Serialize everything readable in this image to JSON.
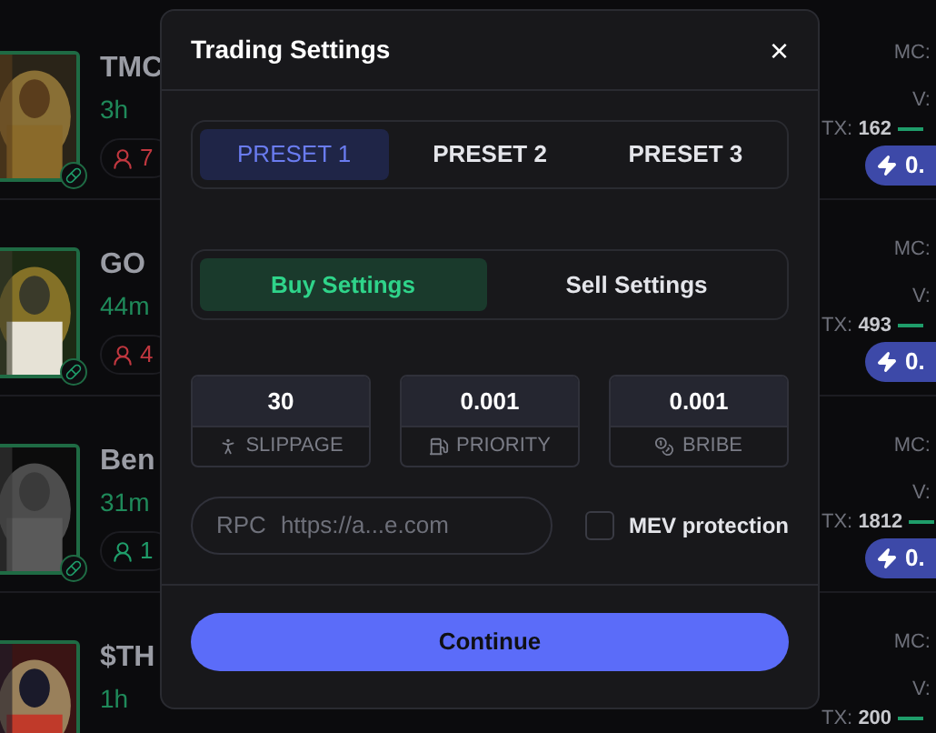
{
  "tokens": [
    {
      "name": "TMC",
      "age": "3h",
      "holders": "7",
      "color": "#c0373f",
      "mc_label": "MC:",
      "v_label": "V:",
      "tx_label": "TX:",
      "tx": "162",
      "buy": "0."
    },
    {
      "name": "GO",
      "age": "44m",
      "holders": "4",
      "color": "#c0373f",
      "mc_label": "MC:",
      "v_label": "V:",
      "tx_label": "TX:",
      "tx": "493",
      "buy": "0."
    },
    {
      "name": "Ben",
      "age": "31m",
      "holders": "1",
      "color": "#1f9d6a",
      "mc_label": "MC:",
      "v_label": "V:",
      "tx_label": "TX:",
      "tx": "1812",
      "buy": "0."
    },
    {
      "name": "$TH",
      "age": "1h",
      "mc_label": "MC:",
      "v_label": "V:",
      "tx_label": "TX:",
      "tx": "200"
    }
  ],
  "dialog": {
    "title": "Trading Settings",
    "close": "×",
    "presets": [
      {
        "label": "PRESET 1",
        "selected": true
      },
      {
        "label": "PRESET 2",
        "selected": false
      },
      {
        "label": "PRESET 3",
        "selected": false
      }
    ],
    "modes": [
      {
        "label": "Buy Settings",
        "selected": true
      },
      {
        "label": "Sell Settings",
        "selected": false
      }
    ],
    "fields": [
      {
        "kind": "slippage",
        "value": "30",
        "label": "SLIPPAGE"
      },
      {
        "kind": "priority",
        "value": "0.001",
        "label": "PRIORITY"
      },
      {
        "kind": "bribe",
        "value": "0.001",
        "label": "BRIBE"
      }
    ],
    "rpc": {
      "label": "RPC",
      "placeholder": "https://a...e.com"
    },
    "mev": {
      "label": "MEV protection",
      "checked": false
    },
    "continue": "Continue"
  }
}
